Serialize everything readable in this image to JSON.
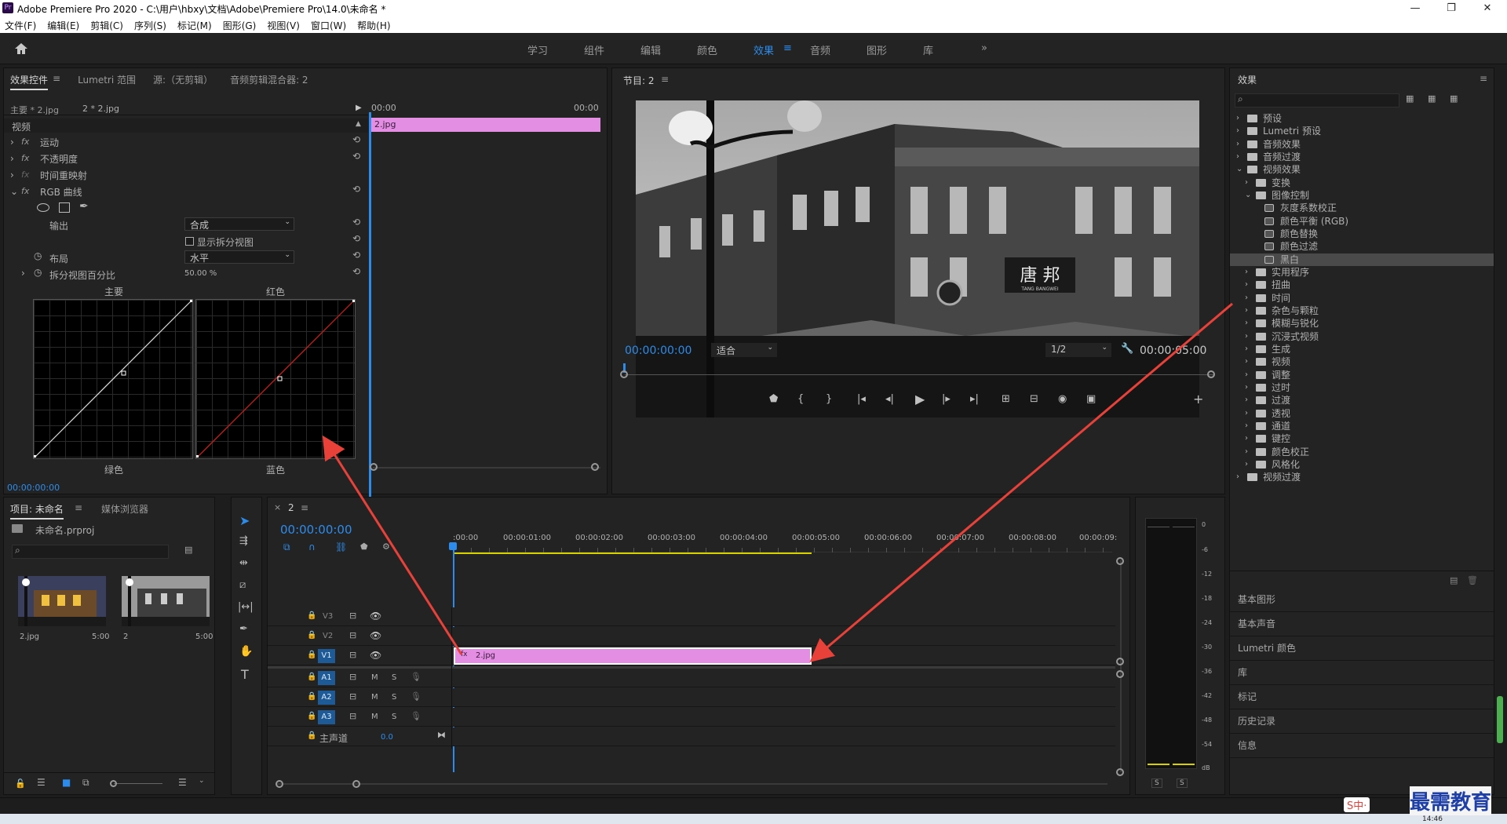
{
  "app": {
    "title": "Adobe Premiere Pro 2020 - C:\\用户\\hbxy\\文档\\Adobe\\Premiere Pro\\14.0\\未命名 *",
    "logo": "Pr"
  },
  "window_controls": {
    "minimize": "—",
    "maximize": "❐",
    "close": "✕"
  },
  "menu": [
    "文件(F)",
    "编辑(E)",
    "剪辑(C)",
    "序列(S)",
    "标记(M)",
    "图形(G)",
    "视图(V)",
    "窗口(W)",
    "帮助(H)"
  ],
  "workspaces": {
    "tabs": [
      "学习",
      "组件",
      "编辑",
      "颜色",
      "效果",
      "音频",
      "图形",
      "库"
    ],
    "active": "效果",
    "more": "»",
    "menu_icon": "≡"
  },
  "effect_controls": {
    "tabs": [
      "效果控件",
      "Lumetri 范围",
      "源:（无剪辑）",
      "音频剪辑混合器: 2"
    ],
    "tab_menu": "≡",
    "master_clip": "主要 * 2.jpg",
    "sequence_clip": "2 * 2.jpg",
    "ruler_start": "00:00",
    "ruler_end": "00:00",
    "clip_name": "2.jpg",
    "section": "视频",
    "fx": "fx",
    "effects": [
      "运动",
      "不透明度",
      "时间重映射",
      "RGB 曲线"
    ],
    "output_label": "输出",
    "output_value": "合成",
    "split_view_label": "显示拆分视图",
    "layout_label": "布局",
    "layout_value": "水平",
    "split_percent_label": "拆分视图百分比",
    "split_percent_value": "50.00 %",
    "curves": {
      "master": "主要",
      "red": "红色",
      "green": "绿色",
      "blue": "蓝色"
    },
    "timecode": "00:00:00:00"
  },
  "program": {
    "title": "节目: 2",
    "menu": "≡",
    "timecode": "00:00:00:00",
    "fit": "适合",
    "resolution": "1/2",
    "duration": "00:00:05:00",
    "sign_text": "唐 邦",
    "sign_sub": "TANG BANGWEI",
    "controls": [
      "marker-icon",
      "mark-in-icon",
      "mark-out-icon",
      "go-to-in-icon",
      "step-back-icon",
      "play-icon",
      "step-forward-icon",
      "go-to-out-icon",
      "lift-icon",
      "extract-icon",
      "export-frame-icon",
      "comparison-view-icon",
      "add-button-icon"
    ]
  },
  "project": {
    "tabs": [
      "项目: 未命名",
      "媒体浏览器"
    ],
    "menu": "≡",
    "file": "未命名.prproj",
    "items": [
      {
        "name": "2.jpg",
        "duration": "5:00"
      },
      {
        "name": "2",
        "duration": "5:00"
      }
    ]
  },
  "tools": [
    "selection-tool-icon",
    "track-select-tool-icon",
    "ripple-edit-tool-icon",
    "razor-tool-icon",
    "slip-tool-icon",
    "pen-tool-icon",
    "hand-tool-icon",
    "type-tool-icon"
  ],
  "timeline": {
    "tab": "2",
    "tab_close": "×",
    "menu": "≡",
    "timecode": "00:00:00:00",
    "ruler": [
      ":00:00",
      "00:00:01:00",
      "00:00:02:00",
      "00:00:03:00",
      "00:00:04:00",
      "00:00:05:00",
      "00:00:06:00",
      "00:00:07:00",
      "00:00:08:00",
      "00:00:09:"
    ],
    "video_tracks": [
      "V3",
      "V2",
      "V1"
    ],
    "audio_tracks": [
      "A1",
      "A2",
      "A3"
    ],
    "master_label": "主声道",
    "master_value": "0.0",
    "clip": "2.jpg",
    "mute": "M",
    "solo": "S"
  },
  "meter": {
    "scale": [
      "0",
      "-6",
      "-12",
      "-18",
      "-24",
      "-30",
      "-36",
      "-42",
      "-48",
      "-54",
      "dB"
    ],
    "solo": [
      "S",
      "S"
    ]
  },
  "effects_panel": {
    "title": "效果",
    "menu": "≡",
    "tree": [
      {
        "label": "预设",
        "level": 0,
        "open": false
      },
      {
        "label": "Lumetri 预设",
        "level": 0,
        "open": false
      },
      {
        "label": "音频效果",
        "level": 0,
        "open": false
      },
      {
        "label": "音频过渡",
        "level": 0,
        "open": false
      },
      {
        "label": "视频效果",
        "level": 0,
        "open": true
      },
      {
        "label": "变换",
        "level": 1,
        "open": false
      },
      {
        "label": "图像控制",
        "level": 1,
        "open": true
      },
      {
        "label": "灰度系数校正",
        "level": 2
      },
      {
        "label": "颜色平衡 (RGB)",
        "level": 2
      },
      {
        "label": "颜色替换",
        "level": 2
      },
      {
        "label": "颜色过滤",
        "level": 2
      },
      {
        "label": "黑白",
        "level": 2,
        "selected": true
      },
      {
        "label": "实用程序",
        "level": 1,
        "open": false
      },
      {
        "label": "扭曲",
        "level": 1,
        "open": false
      },
      {
        "label": "时间",
        "level": 1,
        "open": false
      },
      {
        "label": "杂色与颗粒",
        "level": 1,
        "open": false
      },
      {
        "label": "模糊与锐化",
        "level": 1,
        "open": false
      },
      {
        "label": "沉浸式视频",
        "level": 1,
        "open": false
      },
      {
        "label": "生成",
        "level": 1,
        "open": false
      },
      {
        "label": "视频",
        "level": 1,
        "open": false
      },
      {
        "label": "调整",
        "level": 1,
        "open": false
      },
      {
        "label": "过时",
        "level": 1,
        "open": false
      },
      {
        "label": "过渡",
        "level": 1,
        "open": false
      },
      {
        "label": "透视",
        "level": 1,
        "open": false
      },
      {
        "label": "通道",
        "level": 1,
        "open": false
      },
      {
        "label": "键控",
        "level": 1,
        "open": false
      },
      {
        "label": "颜色校正",
        "level": 1,
        "open": false
      },
      {
        "label": "风格化",
        "level": 1,
        "open": false
      },
      {
        "label": "视频过渡",
        "level": 0,
        "open": false
      }
    ],
    "collapsed": [
      "基本图形",
      "基本声音",
      "Lumetri 颜色",
      "库",
      "标记",
      "历史记录",
      "信息"
    ]
  },
  "watermark": "最需教育",
  "ime": "S中·",
  "clock": "14:46",
  "colors": {
    "accent": "#2d8ceb",
    "clip": "#e38ee3",
    "arrow": "#e8413a",
    "selected": "#4a4a4a"
  }
}
